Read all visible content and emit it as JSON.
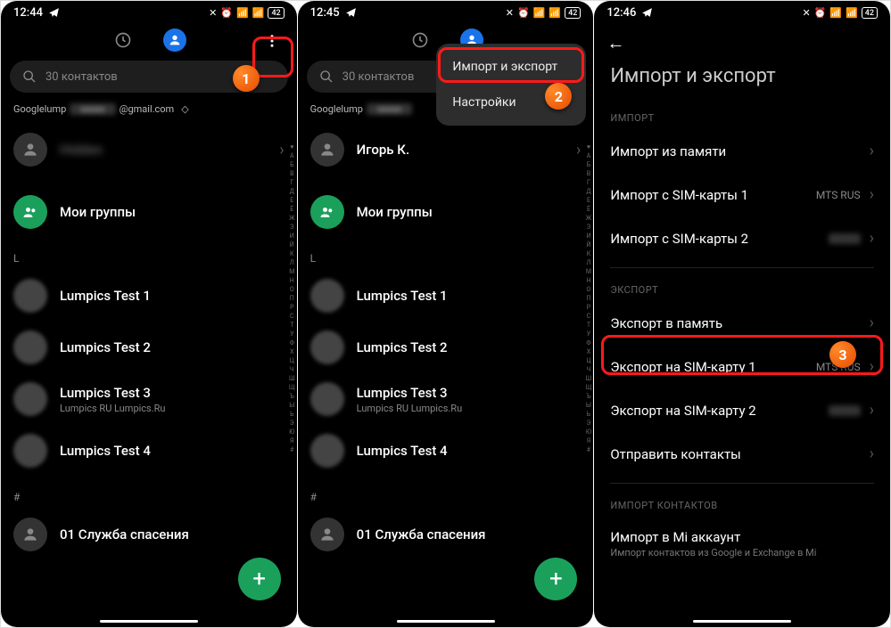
{
  "screens": [
    {
      "time": "12:44",
      "battery": "42"
    },
    {
      "time": "12:45",
      "battery": "42"
    },
    {
      "time": "12:46",
      "battery": "42"
    }
  ],
  "search_placeholder": "30 контактов",
  "account_prefix": "Googlelump",
  "account_suffix": "@gmail.com",
  "contact_hidden": "Игорь К.",
  "groups_label": "Мои группы",
  "section_L": "L",
  "section_hash": "#",
  "contacts_L": [
    {
      "name": "Lumpics Test 1",
      "sub": ""
    },
    {
      "name": "Lumpics Test 2",
      "sub": ""
    },
    {
      "name": "Lumpics Test 3",
      "sub": "Lumpics RU Lumpics.Ru"
    },
    {
      "name": "Lumpics Test 4",
      "sub": ""
    }
  ],
  "contact_emergency": "01 Служба спасения",
  "index_letters": "♥АБВГДЕЁЖЗИЙКЛМНОПРСТУФХЦЧШЩЪЫЬЭЮЯ#",
  "menu": {
    "import_export": "Импорт и экспорт",
    "settings": "Настройки"
  },
  "page3": {
    "title": "Импорт и экспорт",
    "section_import": "ИМПОРТ",
    "import_memory": "Импорт из памяти",
    "import_sim1": "Импорт с SIM-карты 1",
    "import_sim1_val": "MTS RUS",
    "import_sim2": "Импорт с SIM-карты 2",
    "section_export": "ЭКСПОРТ",
    "export_memory": "Экспорт в память",
    "export_sim1": "Экспорт на SIM-карту 1",
    "export_sim1_val": "MTS RUS",
    "export_sim2": "Экспорт на SIM-карту 2",
    "send_contacts": "Отправить контакты",
    "section_import_contacts": "ИМПОРТ КОНТАКТОВ",
    "import_mi": "Импорт в Mi аккаунт",
    "import_mi_sub": "Импорт контактов из Google и Exchange в Mi"
  },
  "badges": {
    "b1": "1",
    "b2": "2",
    "b3": "3"
  }
}
